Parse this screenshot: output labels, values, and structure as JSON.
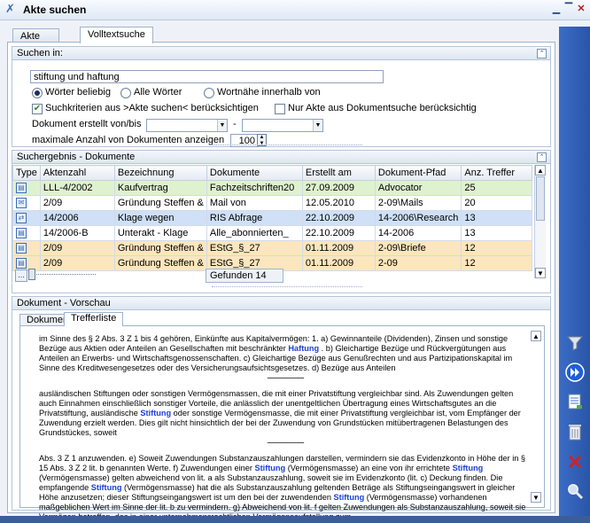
{
  "window": {
    "title": "Akte suchen"
  },
  "tabs": [
    {
      "label": "Akte suchen"
    },
    {
      "label": "Volltextsuche"
    }
  ],
  "search": {
    "header": "Suchen in:",
    "query": "stiftung und haftung",
    "radio_any": "Wörter beliebig",
    "radio_all": "Alle Wörter",
    "radio_near": "Wortnähe innerhalb von",
    "check_criteria": "Suchkriterien aus >Akte suchen< berücksichtigen",
    "check_only": "Nur Akte aus Dokumentsuche berücksichtig",
    "date_label": "Dokument erstellt von/bis",
    "date_sep": "-",
    "max_label": "maximale Anzahl von Dokumenten anzeigen",
    "max_value": "100"
  },
  "results": {
    "header": "Suchergebnis - Dokumente",
    "columns": [
      "Type",
      "Aktenzahl",
      "Bezeichnung",
      "Dokumente",
      "Erstellt am",
      "Dokument-Pfad",
      "Anz. Treffer"
    ],
    "rows": [
      {
        "type": "doc",
        "aktenzahl": "LLL-4/2002",
        "bezeichnung": "Kaufvertrag",
        "dokumente": "Fachzeitschriften20",
        "erstellt": "27.09.2009",
        "pfad": "Advocator",
        "treffer": "25",
        "style": "green"
      },
      {
        "type": "mail",
        "aktenzahl": "2/09",
        "bezeichnung": "Gründung Steffen &",
        "dokumente": "Mail von",
        "erstellt": "12.05.2010",
        "pfad": "2-09\\Mails",
        "treffer": "20",
        "style": "white"
      },
      {
        "type": "web",
        "aktenzahl": "14/2006",
        "bezeichnung": "Klage wegen",
        "dokumente": "RIS Abfrage",
        "erstellt": "22.10.2009",
        "pfad": "14-2006\\Research",
        "treffer": "13",
        "style": "sel"
      },
      {
        "type": "doc",
        "aktenzahl": "14/2006-B",
        "bezeichnung": "Unterakt - Klage",
        "dokumente": "Alle_abonnierten_",
        "erstellt": "22.10.2009",
        "pfad": "14-2006",
        "treffer": "13",
        "style": "white"
      },
      {
        "type": "doc",
        "aktenzahl": "2/09",
        "bezeichnung": "Gründung Steffen &",
        "dokumente": "EStG_§_27",
        "erstellt": "01.11.2009",
        "pfad": "2-09\\Briefe",
        "treffer": "12",
        "style": "orange"
      },
      {
        "type": "doc",
        "aktenzahl": "2/09",
        "bezeichnung": "Gründung Steffen &",
        "dokumente": "EStG_§_27",
        "erstellt": "01.11.2009",
        "pfad": "2-09",
        "treffer": "12",
        "style": "orange"
      }
    ],
    "found": "Gefunden 14"
  },
  "preview": {
    "header": "Dokument - Vorschau",
    "tabs": [
      "Dokument",
      "Trefferliste"
    ],
    "separator": "--------------------",
    "paragraphs": [
      [
        {
          "t": "im Sinne des § 2 Abs. 3 Z 1 bis 4 gehören, Einkünfte aus Kapitalvermögen: 1. a) Gewinnanteile (Dividenden), Zinsen und sonstige Bezüge aus Aktien oder Anteilen an Gesellschaften mit beschränkter "
        },
        {
          "t": "Haftung",
          "hl": true
        },
        {
          "t": " . b) Gleichartige Bezüge und Rückvergütungen aus Anteilen an Erwerbs- und Wirtschaftsgenossenschaften. c) Gleichartige Bezüge aus Genußrechten und aus Partizipationskapital im Sinne des Kreditwesengesetzes oder des Versicherungsaufsichtsgesetzes. d) Bezüge aus Anteilen"
        }
      ],
      [
        {
          "t": "ausländischen Stiftungen oder sonstigen Vermögensmassen, die mit einer Privatstiftung vergleichbar sind. Als Zuwendungen gelten auch Einnahmen einschließlich sonstiger Vorteile, die anlässlich der unentgeltlichen Übertragung eines Wirtschaftsgutes an die Privatstiftung, ausländische "
        },
        {
          "t": "Stiftung",
          "hl": true
        },
        {
          "t": " oder sonstige Vermögensmasse, die mit einer Privatstiftung vergleichbar ist, vom Empfänger der Zuwendung erzielt werden. Dies gilt nicht hinsichtlich der bei der Zuwendung von Grundstücken mitübertragenen Belastungen des Grundstückes, soweit"
        }
      ],
      [
        {
          "t": "Abs. 3 Z 1 anzuwenden. e) Soweit Zuwendungen Substanzauszahlungen darstellen, vermindern sie das Evidenzkonto in Höhe der in § 15 Abs. 3 Z 2 lit. b genannten Werte. f) Zuwendungen einer "
        },
        {
          "t": "Stiftung",
          "hl": true
        },
        {
          "t": " (Vermögensmasse) an eine von ihr errichtete "
        },
        {
          "t": "Stiftung",
          "hl": true
        },
        {
          "t": " (Vermögensmasse) gelten abweichend von lit. a als Substanzauszahlung, soweit sie im Evidenzkonto (lit. c) Deckung finden. Die empfangende "
        },
        {
          "t": "Stiftung",
          "hl": true
        },
        {
          "t": " (Vermögensmasse) hat die als Substanzauszahlung geltenden Beträge als Stiftungseingangswert in gleicher Höhe anzusetzen; dieser Stiftungseingangswert ist um den bei der zuwendenden "
        },
        {
          "t": "Stiftung",
          "hl": true
        },
        {
          "t": " (Vermögensmasse) vorhandenen maßgeblichen Wert im Sinne der lit. b zu vermindern. g) Abweichend von lit. f gelten Zuwendungen als Substanzauszahlung, soweit sie Vermögen betreffen, das in einer unternehmensrechtlichen Vermögensaufstellung zum"
        }
      ]
    ]
  },
  "sidebar_icons": [
    "funnel-icon",
    "fast-forward-icon",
    "document-list-icon",
    "trash-icon",
    "delete-x-icon",
    "magnifier-icon"
  ]
}
